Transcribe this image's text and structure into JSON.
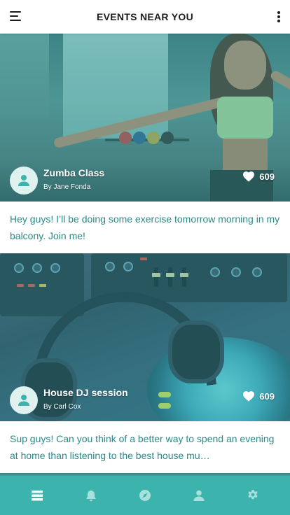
{
  "header": {
    "title": "EVENTS NEAR YOU",
    "left_icon": "menu-icon",
    "right_icon": "more-vertical-icon"
  },
  "events": [
    {
      "title": "Zumba Class",
      "author": "By Jane Fonda",
      "likes": "609",
      "description": "Hey guys! I’ll be doing some exercise tomorrow morning in my balcony. Join me!"
    },
    {
      "title": "House DJ session",
      "author": "By Carl Cox",
      "likes": "609",
      "description": "Sup guys! Can you think of a better way to spend an evening at home than listening to the best house mu…"
    }
  ],
  "bottom_nav": {
    "items": [
      {
        "icon": "feed-icon",
        "active": true
      },
      {
        "icon": "bell-icon",
        "active": false
      },
      {
        "icon": "compass-icon",
        "active": false
      },
      {
        "icon": "user-icon",
        "active": false
      },
      {
        "icon": "gear-icon",
        "active": false
      }
    ]
  },
  "colors": {
    "accent": "#3db3ad",
    "text_accent": "#2a8a88",
    "avatar_bg": "#dff2ef",
    "nav_active": "#ffffff",
    "nav_inactive": "#a8e0dc"
  }
}
